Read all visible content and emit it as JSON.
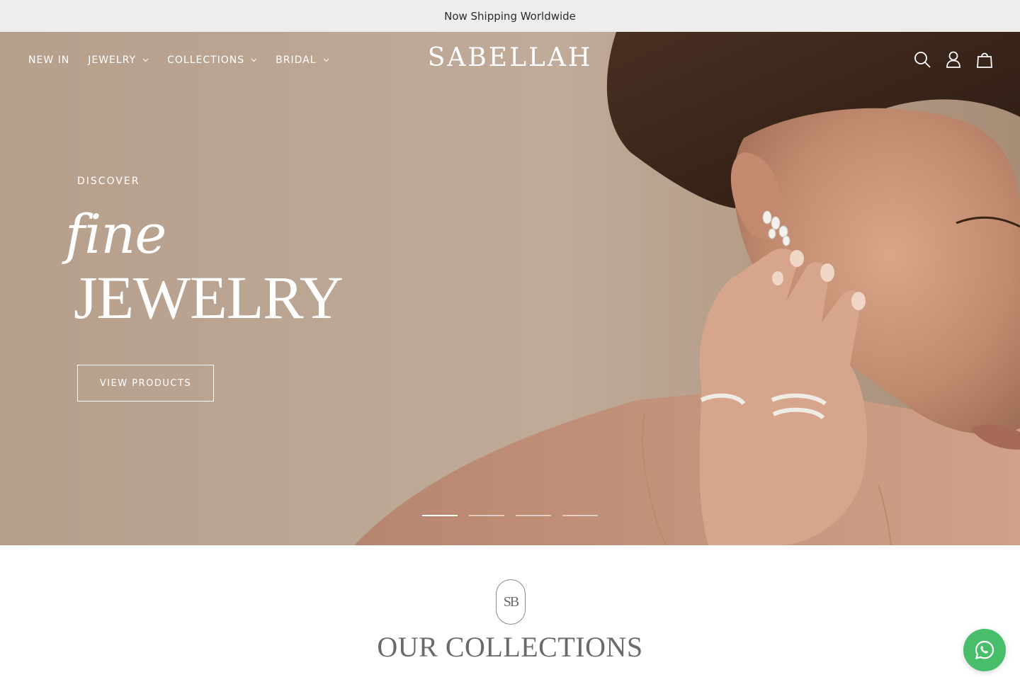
{
  "announcement": {
    "text": "Now Shipping Worldwide"
  },
  "header": {
    "nav": [
      {
        "label": "NEW IN",
        "has_dropdown": false
      },
      {
        "label": "JEWELRY",
        "has_dropdown": true
      },
      {
        "label": "COLLECTIONS",
        "has_dropdown": true
      },
      {
        "label": "BRIDAL",
        "has_dropdown": true
      }
    ],
    "logo": "SABELLAH",
    "icons": [
      "search-icon",
      "account-icon",
      "cart-icon"
    ]
  },
  "hero": {
    "eyebrow": "DISCOVER",
    "title_script": "fine",
    "title_main": "JEWELRY",
    "cta_label": "VIEW PRODUCTS",
    "slides_total": 4,
    "active_slide": 1
  },
  "collections": {
    "monogram": "SB",
    "title": "OUR COLLECTIONS"
  },
  "whatsapp": {
    "icon": "whatsapp-icon",
    "color": "#48bd6a"
  },
  "colors": {
    "hero_bg": "#bba593",
    "announcement_bg": "#efedeb",
    "heading_gray": "#6a6a6a"
  }
}
